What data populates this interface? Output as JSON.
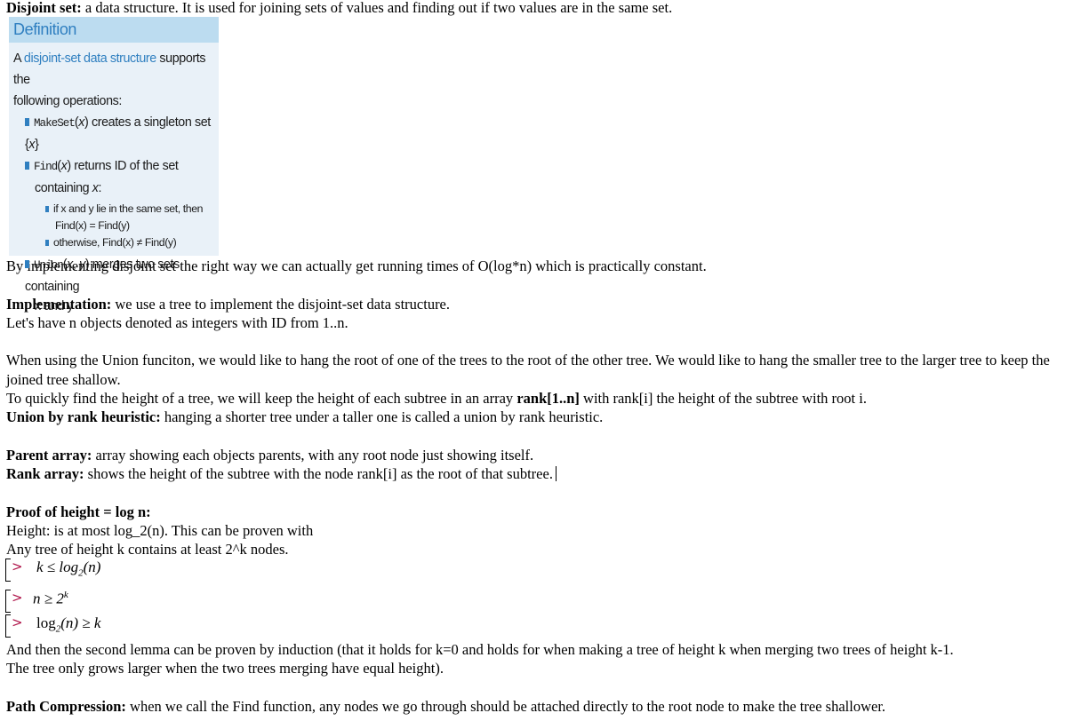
{
  "intro": {
    "term": "Disjoint set:",
    "text": " a data structure. It is used for joining sets of values and finding out if two values are in the same set."
  },
  "definition": {
    "header": "Definition",
    "lead_a": "A ",
    "lead_link": "disjoint-set data structure",
    "lead_b": " supports the",
    "lead_c": "following operations:",
    "makeset_fn": "MakeSet",
    "makeset_text": " creates a singleton set ",
    "find_fn": "Find",
    "find_text": " returns ID of the set",
    "find_cont": "containing ",
    "sub1_a": "if x and y lie in the same set, then",
    "sub1_b": "Find(x) = Find(y)",
    "sub2": "otherwise, Find(x) ≠ Find(y)",
    "union_fn": "Union",
    "union_text": " merges two sets containing",
    "union_cont": "x and y"
  },
  "para_runtime": "By implementing disjoint set the right way we can actually get running times of O(log*n) which is practically constant.",
  "impl": {
    "term": "Implementation:",
    "text": " we use a tree to implement the disjoint-set data structure.",
    "line2": "Let's have n objects denoted as integers with ID from 1..n."
  },
  "union_para": {
    "text": "When using the Union funciton, we would like to hang the root of one of the trees to the root of the other tree. We would like to hang the smaller tree to the larger tree to keep the joined tree shallow.",
    "rank_a": "To quickly find the height of a tree, we will keep the height of each subtree in an array ",
    "rank_b": "rank[1..n]",
    "rank_c": " with rank[i] the height of the subtree with root i.",
    "heur_term": "Union by rank heuristic:",
    "heur_text": " hanging a shorter tree under a taller one is called a union by rank heuristic."
  },
  "arrays": {
    "parent_term": "Parent array:",
    "parent_text": " array showing each objects parents, with any root node just showing itself.",
    "rank_term": "Rank array:",
    "rank_text": " shows the height of the subtree with the node rank[i] as the root of that subtree."
  },
  "proof": {
    "term": "Proof of height = log n:",
    "line1": "Height: is at most log_2(n). This can be proven with",
    "line2": "Any tree of height k contains at least 2^k nodes."
  },
  "prompts": {
    "symbol": ">",
    "p1_a": "k ≤ log",
    "p1_sub": "2",
    "p1_b": "(n)",
    "p2_a": "n ≥ 2",
    "p2_sup": "k",
    "p3_a": "log",
    "p3_sub": "2",
    "p3_b": "(n) ≥ k"
  },
  "lemma": {
    "line1": "And then the second lemma can be proven by induction (that it holds for k=0 and holds for when making a tree of height k when merging two trees of height k-1.",
    "line2": "The tree only grows larger when the two trees merging have equal height)."
  },
  "path": {
    "term": "Path Compression:",
    "text": " when we call the Find function, any nodes we go through should be attached directly to the root node to make the tree shallower."
  }
}
